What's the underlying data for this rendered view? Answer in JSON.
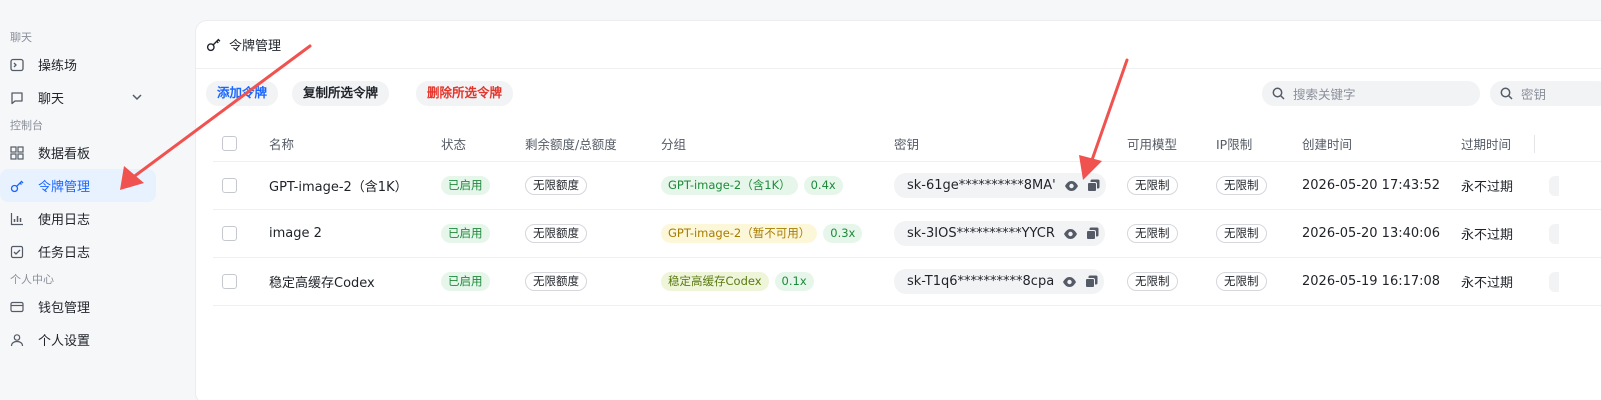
{
  "sidebar": {
    "sections": [
      {
        "label": "聊天",
        "items": [
          {
            "label": "操练场",
            "icon": "terminal-icon"
          },
          {
            "label": "聊天",
            "icon": "chat-icon",
            "expandable": true
          }
        ]
      },
      {
        "label": "控制台",
        "items": [
          {
            "label": "数据看板",
            "icon": "dashboard-icon"
          },
          {
            "label": "令牌管理",
            "icon": "key-icon",
            "active": true
          },
          {
            "label": "使用日志",
            "icon": "chart-icon"
          },
          {
            "label": "任务日志",
            "icon": "checklist-icon"
          }
        ]
      },
      {
        "label": "个人中心",
        "items": [
          {
            "label": "钱包管理",
            "icon": "wallet-icon"
          },
          {
            "label": "个人设置",
            "icon": "user-icon"
          }
        ]
      }
    ]
  },
  "page": {
    "title": "令牌管理",
    "buttons": {
      "add": "添加令牌",
      "copy_selected": "复制所选令牌",
      "delete_selected": "删除所选令牌"
    },
    "search": {
      "keyword_placeholder": "搜索关键字",
      "key_placeholder": "密钥"
    }
  },
  "table": {
    "columns": [
      "名称",
      "状态",
      "剩余额度/总额度",
      "分组",
      "密钥",
      "可用模型",
      "IP限制",
      "创建时间",
      "过期时间"
    ],
    "rows": [
      {
        "name": "GPT-image-2（含1K）",
        "status": "已启用",
        "quota": "无限额度",
        "group": "GPT-image-2（含1K）",
        "group_style": "green",
        "ratio": "0.4x",
        "key": "sk-61ge**********8MA'",
        "models": "无限制",
        "ip": "无限制",
        "created": "2026-05-20 17:43:52",
        "expires": "永不过期"
      },
      {
        "name": "image 2",
        "status": "已启用",
        "quota": "无限额度",
        "group": "GPT-image-2（暂不可用）",
        "group_style": "yellow",
        "ratio": "0.3x",
        "key": "sk-3IOS**********YYCR",
        "models": "无限制",
        "ip": "无限制",
        "created": "2026-05-20 13:40:06",
        "expires": "永不过期"
      },
      {
        "name": "稳定高缓存Codex",
        "status": "已启用",
        "quota": "无限额度",
        "group": "稳定高缓存Codex",
        "group_style": "olive",
        "ratio": "0.1x",
        "key": "sk-T1q6**********8cpa",
        "models": "无限制",
        "ip": "无限制",
        "created": "2026-05-19 16:17:08",
        "expires": "永不过期"
      }
    ]
  },
  "colors": {
    "accent": "#1a66ff",
    "danger": "#e5352b",
    "success": "#1f8a3b",
    "arrow": "#f0524f"
  }
}
